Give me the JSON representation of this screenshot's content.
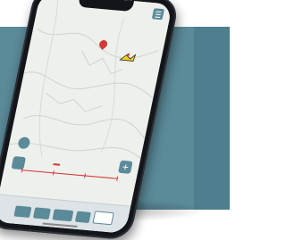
{
  "colors": {
    "accent": "#5b8a99",
    "marker": "#d23a3a",
    "map_background": "#eef0ec",
    "phone_body": "#121519"
  },
  "map": {
    "icons": [
      "map-pin-icon",
      "track-icon",
      "hamburger-icon",
      "plus-icon"
    ]
  },
  "controls": {
    "plus_label": "+"
  },
  "bottom_bar": {
    "buttons": [
      "",
      "",
      "",
      "",
      ""
    ]
  }
}
